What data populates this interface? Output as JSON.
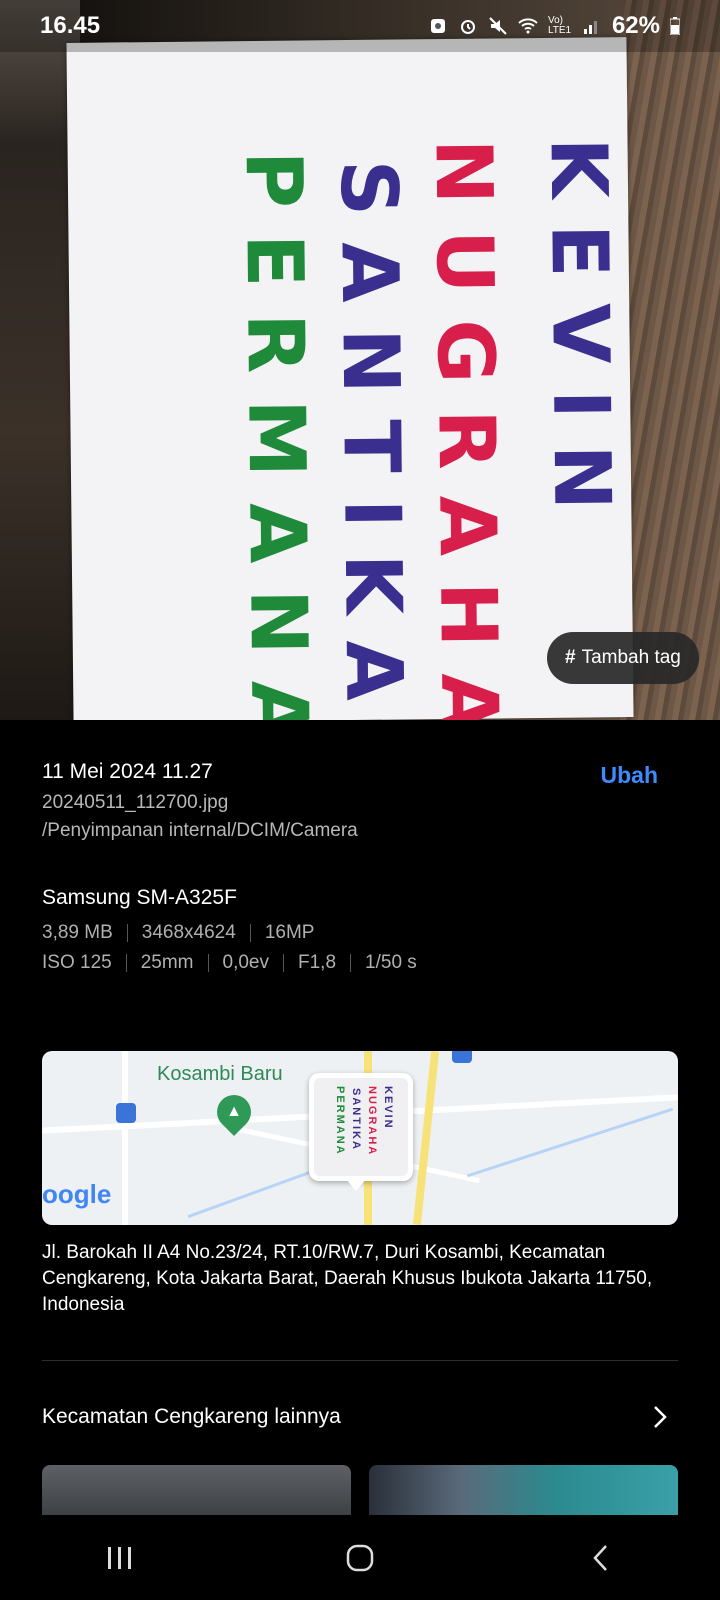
{
  "status": {
    "time": "16.45",
    "network": "Vo) LTE1",
    "battery": "62%"
  },
  "photo": {
    "handwriting": [
      "KEVIN",
      "NUGRAHA",
      "SANTIKA",
      "PERMANA"
    ],
    "tag_button": "Tambah tag"
  },
  "details": {
    "date": "11 Mei 2024 11.27",
    "edit_label": "Ubah",
    "filename": "20240511_112700.jpg",
    "path": "/Penyimpanan internal/DCIM/Camera",
    "device": "Samsung SM-A325F",
    "specs_row1": [
      "3,89 MB",
      "3468x4624",
      "16MP"
    ],
    "specs_row2": [
      "ISO 125",
      "25mm",
      "0,0ev",
      "F1,8",
      "1/50 s"
    ]
  },
  "map": {
    "place_label": "Kosambi Baru",
    "google": "oogle"
  },
  "address": "Jl. Barokah II A4 No.23/24, RT.10/RW.7, Duri Kosambi, Kecamatan Cengkareng, Kota Jakarta Barat, Daerah Khusus Ibukota Jakarta 11750, Indonesia",
  "more": {
    "label": "Kecamatan Cengkareng lainnya"
  },
  "colors": {
    "accent": "#3d8bff",
    "ink_purple": "#3a2f8f",
    "ink_red": "#d81f4b",
    "ink_green": "#1e8a3a"
  }
}
